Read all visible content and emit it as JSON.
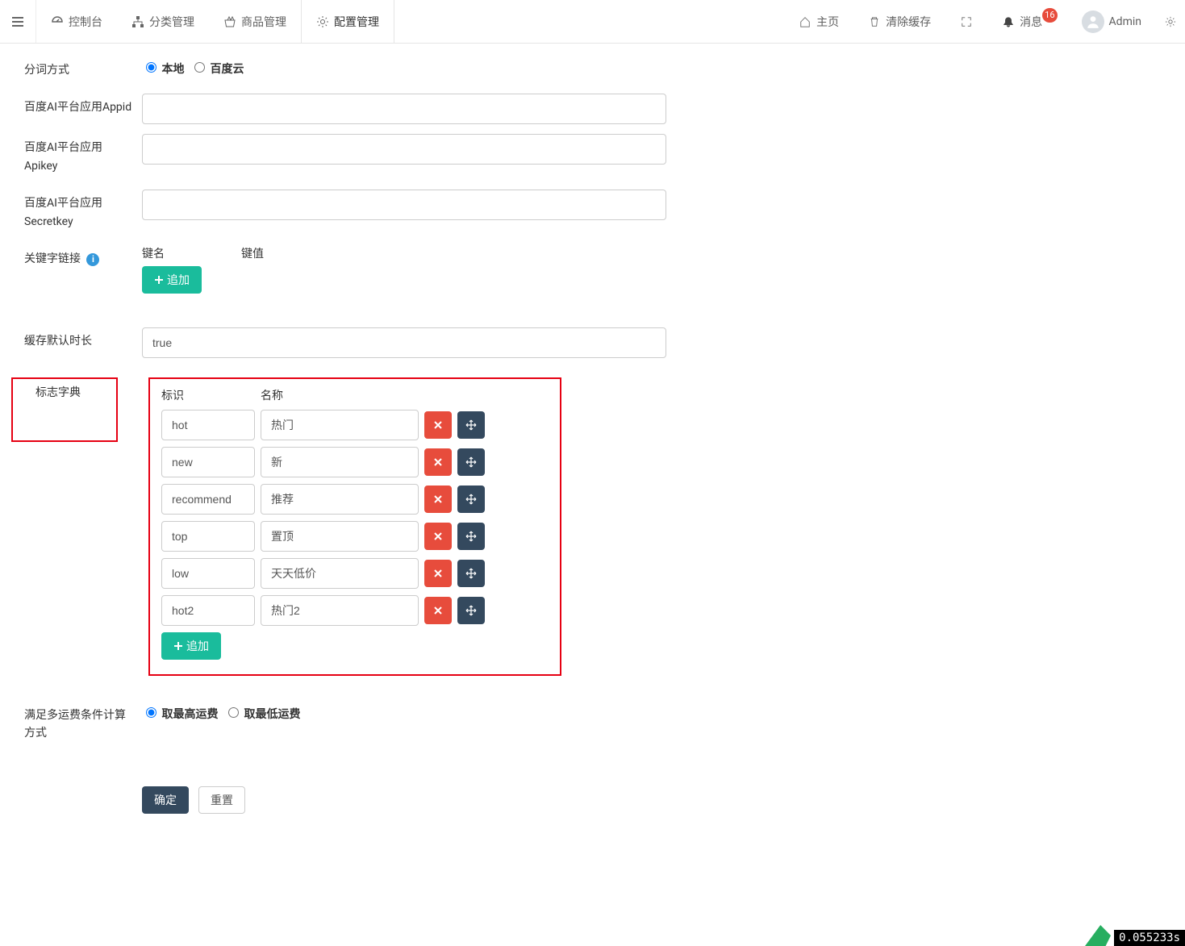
{
  "nav": {
    "left": [
      {
        "label": "控制台",
        "icon": "dashboard"
      },
      {
        "label": "分类管理",
        "icon": "sitemap"
      },
      {
        "label": "商品管理",
        "icon": "basket"
      },
      {
        "label": "配置管理",
        "icon": "gear",
        "active": true
      }
    ],
    "right": {
      "home": "主页",
      "clear_cache": "清除缓存",
      "messages": "消息",
      "message_count": "16",
      "user": "Admin"
    }
  },
  "form": {
    "seg_label": "分词方式",
    "seg_options": {
      "local": "本地",
      "cloud": "百度云"
    },
    "appid_label": "百度AI平台应用Appid",
    "appid_value": "",
    "apikey_label": "百度AI平台应用Apikey",
    "apikey_value": "",
    "secret_label": "百度AI平台应用Secretkey",
    "secret_value": "",
    "keyword_link_label": "关键字链接",
    "kv_header": {
      "key": "键名",
      "value": "键值"
    },
    "append_label": "追加",
    "cache_label": "缓存默认时长",
    "cache_value": "true",
    "flag_label": "标志字典",
    "flag_header": {
      "id": "标识",
      "name": "名称"
    },
    "flag_rows": [
      {
        "id": "hot",
        "name": "热门"
      },
      {
        "id": "new",
        "name": "新"
      },
      {
        "id": "recommend",
        "name": "推荐"
      },
      {
        "id": "top",
        "name": "置顶"
      },
      {
        "id": "low",
        "name": "天天低价"
      },
      {
        "id": "hot2",
        "name": "热门2"
      }
    ],
    "shipping_label": "满足多运费条件计算方式",
    "shipping_options": {
      "high": "取最高运费",
      "low": "取最低运费"
    },
    "submit": "确定",
    "reset": "重置"
  },
  "debug_time": "0.055233s"
}
